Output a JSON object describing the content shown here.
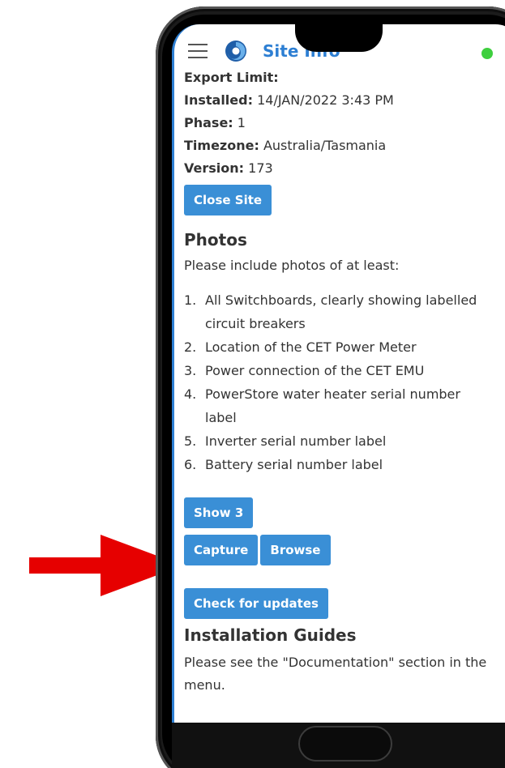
{
  "header": {
    "title": "Site Info",
    "menu_icon": "hamburger-icon",
    "logo_icon": "swirl-logo-icon",
    "status_color": "#3ecf3e"
  },
  "site_info": {
    "export_limit_label": "Export Limit:",
    "export_limit_value": "",
    "installed_label": "Installed:",
    "installed_value": "14/JAN/2022 3:43 PM",
    "phase_label": "Phase:",
    "phase_value": "1",
    "timezone_label": "Timezone:",
    "timezone_value": "Australia/Tasmania",
    "version_label": "Version:",
    "version_value": "173",
    "close_site_label": "Close Site"
  },
  "photos": {
    "title": "Photos",
    "intro": "Please include photos of at least:",
    "items": [
      {
        "num": "1.",
        "text": "All Switchboards, clearly showing labelled circuit breakers"
      },
      {
        "num": "2.",
        "text": "Location of the CET Power Meter"
      },
      {
        "num": "3.",
        "text": "Power connection of the CET EMU"
      },
      {
        "num": "4.",
        "text": "PowerStore water heater serial number label"
      },
      {
        "num": "5.",
        "text": "Inverter serial number label"
      },
      {
        "num": "6.",
        "text": "Battery serial number label"
      }
    ],
    "show_label": "Show 3",
    "capture_label": "Capture",
    "browse_label": "Browse",
    "check_updates_label": "Check for updates"
  },
  "guides": {
    "title": "Installation Guides",
    "text": "Please see the \"Documentation\" section in the menu."
  },
  "colors": {
    "accent": "#2d7fd3",
    "button": "#3a8fd6",
    "arrow": "#e60000"
  }
}
